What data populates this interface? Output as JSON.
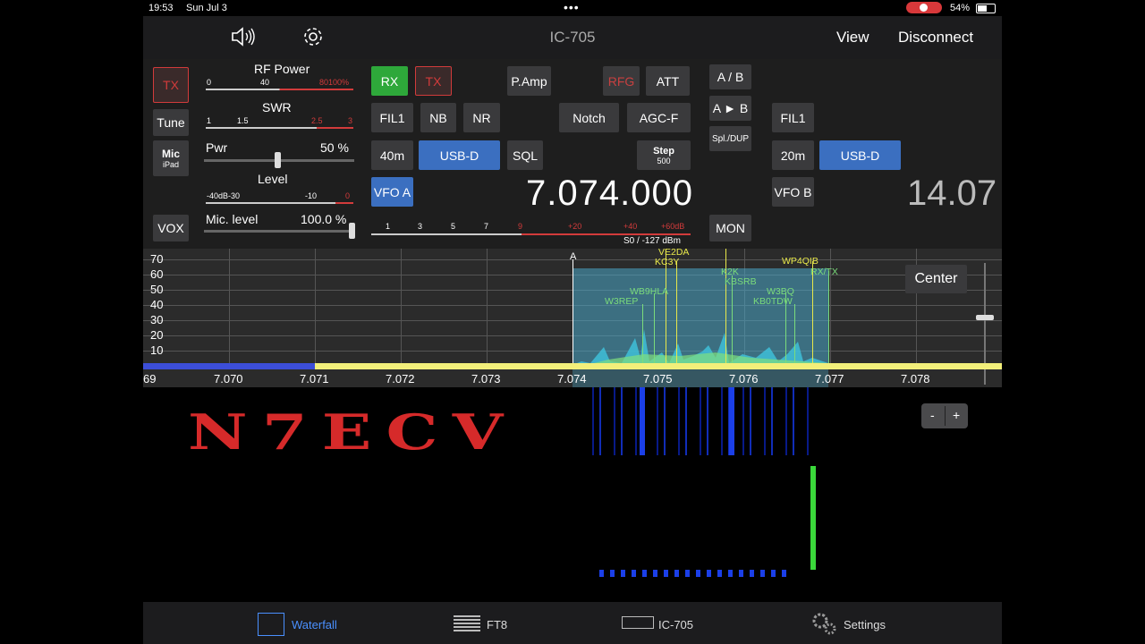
{
  "status": {
    "time": "19:53",
    "date": "Sun Jul 3",
    "battery": "54%"
  },
  "nav": {
    "title": "IC-705",
    "view": "View",
    "disconnect": "Disconnect"
  },
  "left": {
    "tx": "TX",
    "tune": "Tune",
    "mic_top": "Mic",
    "mic_sub": "iPad",
    "vox": "VOX"
  },
  "meters": {
    "rf_power": "RF Power",
    "rf_scale": [
      "0",
      "40",
      "80100%"
    ],
    "swr": "SWR",
    "swr_scale": [
      "1",
      "1.5",
      "2.5",
      "3"
    ],
    "pwr_label": "Pwr",
    "pwr_value": "50 %",
    "pwr_fraction": 0.5,
    "level": "Level",
    "level_scale": [
      "-40dB-30",
      "-10",
      "0"
    ],
    "mic_level_label": "Mic. level",
    "mic_level_value": "100.0 %",
    "mic_fraction": 1.0
  },
  "main": {
    "rx": "RX",
    "tx": "TX",
    "pamp": "P.Amp",
    "rfg": "RFG",
    "att": "ATT",
    "fil1": "FIL1",
    "nb": "NB",
    "nr": "NR",
    "notch": "Notch",
    "agc": "AGC-F",
    "band": "40m",
    "mode": "USB-D",
    "sql": "SQL",
    "step": "Step",
    "step_val": "500",
    "vfo_a": "VFO A",
    "freq": "7.074.000",
    "s_scale": [
      "1",
      "3",
      "5",
      "7",
      "9",
      "+20",
      "+40",
      "+60dB"
    ],
    "s_reading": "S0 / -127 dBm"
  },
  "sub": {
    "ab": "A / B",
    "a_to_b": "A ► B",
    "split": "Spl./DUP",
    "mon": "MON",
    "fil1": "FIL1",
    "band": "20m",
    "mode": "USB-D",
    "vfo_b": "VFO B",
    "freq": "14.07"
  },
  "spectrum": {
    "db_labels": [
      "70",
      "60",
      "50",
      "40",
      "30",
      "20",
      "10"
    ],
    "freq_labels": [
      "69",
      "7.070",
      "7.071",
      "7.072",
      "7.073",
      "7.074",
      "7.075",
      "7.076",
      "7.077",
      "7.078"
    ],
    "marker_a": "A",
    "center": "Center",
    "callsigns": [
      "VE2DA",
      "KC3Y",
      "K2K",
      "KBSRB",
      "WP4QIB",
      "RX/TX",
      "WB9HLA",
      "W3REP",
      "W3BQ",
      "KB0TDW"
    ]
  },
  "waterfall": {
    "logo": "N7ECV",
    "minus": "-",
    "plus": "+"
  },
  "tabs": {
    "waterfall": "Waterfall",
    "ft8": "FT8",
    "ic705": "IC-705",
    "settings": "Settings"
  },
  "colors": {
    "accent_blue": "#3b6fc0",
    "rx_green": "#2ea83a",
    "tx_red": "#d23b3b",
    "passband": "#4aa8c8"
  }
}
